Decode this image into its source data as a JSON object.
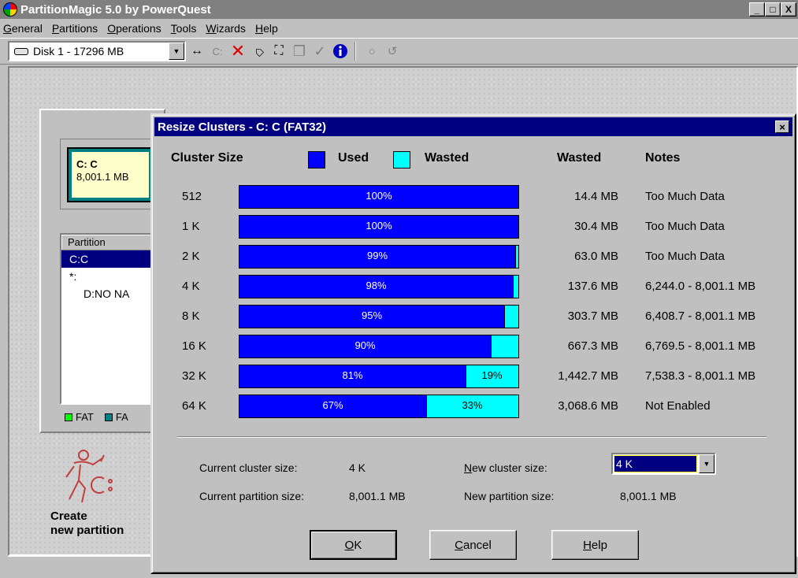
{
  "window": {
    "title": "PartitionMagic 5.0 by PowerQuest",
    "minimize": "_",
    "maximize": "□",
    "close": "X"
  },
  "menu": [
    {
      "label": "General",
      "mnemonic": "G",
      "rest": "eneral"
    },
    {
      "label": "Partitions",
      "mnemonic": "P",
      "rest": "artitions"
    },
    {
      "label": "Operations",
      "mnemonic": "O",
      "rest": "perations"
    },
    {
      "label": "Tools",
      "mnemonic": "T",
      "rest": "ools"
    },
    {
      "label": "Wizards",
      "mnemonic": "W",
      "rest": "izards"
    },
    {
      "label": "Help",
      "mnemonic": "H",
      "rest": "elp"
    }
  ],
  "toolbar": {
    "disk_select": "Disk 1 - 17296 MB",
    "icons": [
      "resize-icon",
      "drive-icon",
      "delete-icon",
      "label-icon",
      "select-icon",
      "copy-icon",
      "apply-icon",
      "info-icon",
      "undo-icon",
      "redo-icon"
    ]
  },
  "sidebar": {
    "partition_block": {
      "name": "C:  C",
      "size": "8,001.1 MB"
    },
    "table_header": "Partition",
    "rows": [
      {
        "label": "C:C",
        "selected": true,
        "indent": false
      },
      {
        "label": "*:",
        "selected": false,
        "indent": false
      },
      {
        "label": "D:NO NA",
        "selected": false,
        "indent": true
      }
    ],
    "legend": [
      {
        "label": "FAT",
        "color": "#00ff00"
      },
      {
        "label": "FA",
        "color": "#008080"
      }
    ],
    "create_label_1": "Create",
    "create_label_2": "new partition"
  },
  "dialog": {
    "title": "Resize Clusters - C: C (FAT32)",
    "close": "×",
    "headers": {
      "cluster_size": "Cluster Size",
      "used": "Used",
      "wasted_legend": "Wasted",
      "wasted": "Wasted",
      "notes": "Notes"
    },
    "colors": {
      "used": "#0000ff",
      "wasted": "#00ffff"
    },
    "current_cluster_label": "Current cluster size:",
    "current_cluster_value": "4 K",
    "current_partition_label": "Current partition size:",
    "current_partition_value": "8,001.1 MB",
    "new_cluster_label": "New cluster size:",
    "new_cluster_mnemonic": "N",
    "new_cluster_rest": "ew cluster size:",
    "new_cluster_value": "4 K",
    "new_partition_label": "New partition size:",
    "new_partition_value": "8,001.1 MB",
    "buttons": {
      "ok": {
        "mnemonic": "O",
        "rest": "K"
      },
      "cancel": {
        "mnemonic": "C",
        "rest": "ancel"
      },
      "help": {
        "mnemonic": "H",
        "rest": "elp"
      }
    }
  },
  "chart_data": {
    "type": "bar",
    "stacked": true,
    "categories": [
      "512",
      "1 K",
      "2 K",
      "4 K",
      "8 K",
      "16 K",
      "32 K",
      "64 K"
    ],
    "series": [
      {
        "name": "Used",
        "values": [
          100,
          100,
          99,
          98,
          95,
          90,
          81,
          67
        ]
      },
      {
        "name": "Wasted",
        "values": [
          0,
          0,
          1,
          2,
          5,
          10,
          19,
          33
        ]
      }
    ],
    "used_labels": [
      "100%",
      "100%",
      "99%",
      "98%",
      "95%",
      "90%",
      "81%",
      "67%"
    ],
    "wasted_labels": [
      "",
      "",
      "",
      "",
      "",
      "",
      "19%",
      "33%"
    ],
    "wasted_mb": [
      "14.4 MB",
      "30.4 MB",
      "63.0 MB",
      "137.6 MB",
      "303.7 MB",
      "667.3 MB",
      "1,442.7 MB",
      "3,068.6 MB"
    ],
    "notes": [
      "Too Much Data",
      "Too Much Data",
      "Too Much Data",
      "6,244.0 - 8,001.1 MB",
      "6,408.7 - 8,001.1 MB",
      "6,769.5 - 8,001.1 MB",
      "7,538.3 - 8,001.1 MB",
      "Not Enabled"
    ]
  }
}
